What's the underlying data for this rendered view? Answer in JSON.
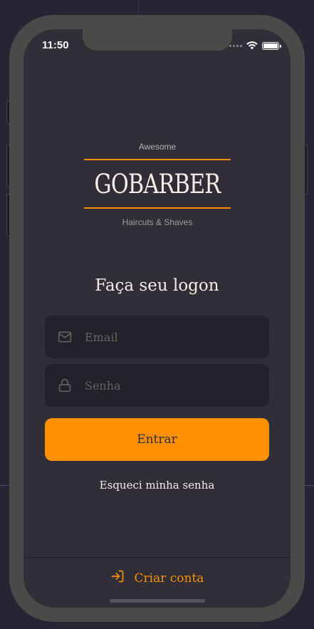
{
  "status_bar": {
    "time": "11:50"
  },
  "logo": {
    "top_text": "Awesome",
    "brand": "GOBARBER",
    "bottom_text": "Haircuts & Shaves"
  },
  "page": {
    "title": "Faça seu logon"
  },
  "form": {
    "email_placeholder": "Email",
    "password_placeholder": "Senha",
    "submit_label": "Entrar"
  },
  "links": {
    "forgot_password": "Esqueci minha senha",
    "create_account": "Criar conta"
  },
  "icons": {
    "email": "mail-icon",
    "password": "lock-icon",
    "create_account": "log-in-icon"
  },
  "colors": {
    "accent": "#ff9000",
    "background": "#312e38",
    "input_background": "#232129",
    "text": "#f4ede8",
    "placeholder": "#666360"
  }
}
